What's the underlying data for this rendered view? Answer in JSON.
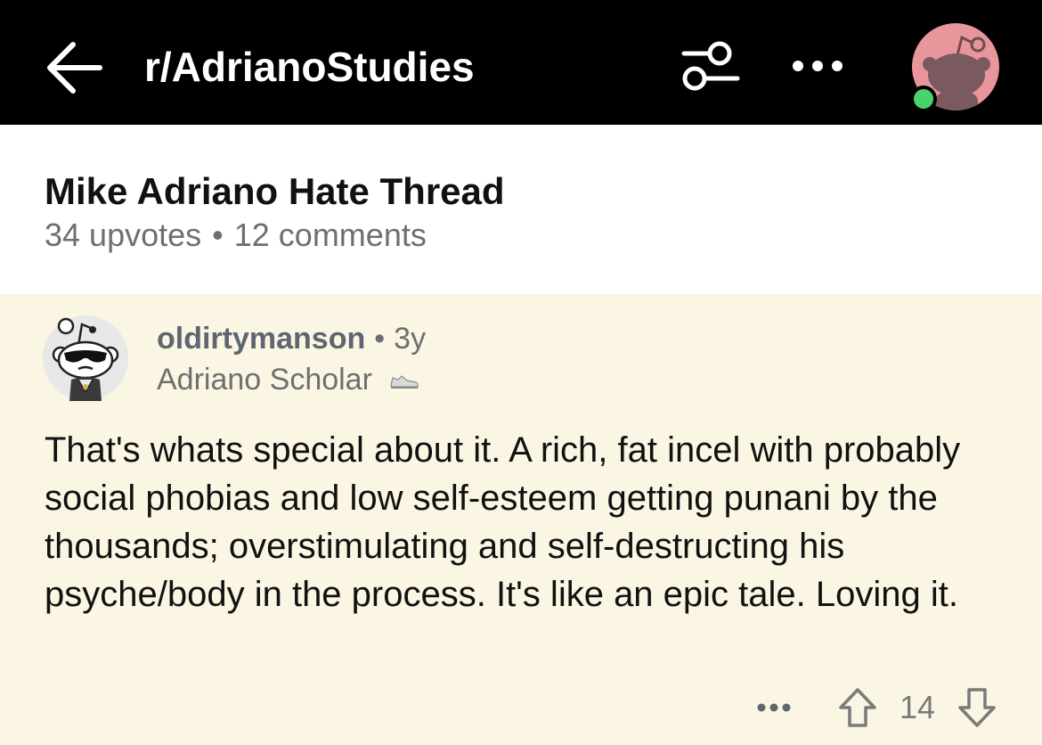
{
  "header": {
    "back_icon": "arrow-left-icon",
    "subreddit": "r/AdrianoStudies",
    "filter_icon": "sort-filter-icon",
    "more_icon": "ellipsis-icon",
    "avatar_icon": "snoo-avatar-icon",
    "avatar_color": "#e9959c",
    "online_color": "#4bd36b"
  },
  "post": {
    "title": "Mike Adriano Hate Thread",
    "upvotes": "34 upvotes",
    "separator": "•",
    "comments": "12 comments"
  },
  "comment": {
    "background": "#fbf5e3",
    "username": "oldirtymanson",
    "separator": "•",
    "age": "3y",
    "flair": "Adriano Scholar",
    "flair_icon": "sneaker-icon",
    "body": "That's whats special about it. A rich, fat incel with probably social phobias and low self-esteem getting punani by the thousands; overstimulating and self-destructing his psyche/body in the process. It's like an epic tale. Loving it.",
    "score": "14",
    "more_icon": "ellipsis-icon",
    "upvote_icon": "upvote-arrow-icon",
    "downvote_icon": "downvote-arrow-icon"
  }
}
